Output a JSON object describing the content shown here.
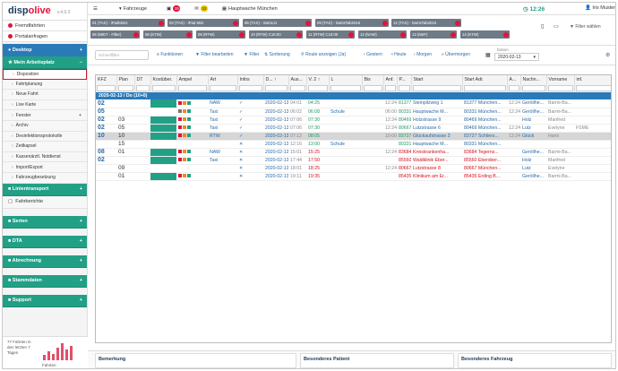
{
  "app": {
    "logo_a": "disp",
    "logo_b": "olive",
    "version": "v.4.9.3"
  },
  "topbar": {
    "fahrzeuge_label": "Fahrzeuge",
    "count_red": "15",
    "count_yellow": "33",
    "location": "Hauptwache München",
    "clock": "12:26",
    "user": "Iris Muster"
  },
  "sidebar": {
    "fremdfahrten": "Fremdfahrten",
    "portalanfragen": "Portalanfragen",
    "desktop": "Desktop",
    "mein_arbeitsplatz": "Mein Arbeitsplatz",
    "subitems": [
      "Disposition",
      "Fahrtplanung",
      "Neue Fahrt",
      "Live Karte",
      "Fenster",
      "Archiv",
      "Desinfektionsprotokolle",
      "Zeitkapsel",
      "Kassenärztl. Notdienst",
      "Import/Export",
      "Fahrzeugbesetzung"
    ],
    "linientransport": "Linientransport",
    "fahrberichte": "Fahrberichte",
    "groups": [
      "Serien",
      "DTA",
      "Abrechnung",
      "Stammdaten",
      "Support"
    ],
    "stats_text": "77 Fahrten in den letzten 7 Tagen",
    "stats_label": "Fahrten",
    "stats_values": [
      0.3,
      0.5,
      0.35,
      0.7,
      0.95,
      0.6,
      0.8
    ]
  },
  "filter_tabs": [
    "01 (TAX) - iPadMini2",
    "03 (TAX) - iPad Mini",
    "06 (TAX) - SamsJ1",
    "09 (TAX) - SamsTab2016",
    "12 (TAX) - SamsTab2016",
    "06 (MIET - Filter)",
    "08 (KTW)",
    "09 (RTW)",
    "10 (RTW) C16:00",
    "11 (RTW) C16:00",
    "12 (NAW)",
    "13 (NEF)",
    "14 (KTW)"
  ],
  "filter_waehlen": "Filter wählen",
  "toolbar": {
    "search_placeholder": "Schnellfilter",
    "funktionen": "Funktionen",
    "filter_bearbeiten": "Filter bearbeiten",
    "filter": "Filter",
    "sortierung": "Sortierung",
    "route": "Route anzeigen (Ja)",
    "gestern": "Gestern",
    "heute": "Heute",
    "morgen": "Morgen",
    "uebermorgen": "Übermorgen",
    "datum_label": "Datum",
    "datum": "2020-02-13"
  },
  "table": {
    "columns": [
      "KFZ",
      "Plan",
      "DT",
      "Kostüber.",
      "Ampel",
      "Art",
      "Infos",
      "D... ↑",
      "Aus...",
      "V. 2 ↑",
      "L",
      "Bis",
      "Anf.",
      "P...",
      "Start",
      "Start Adr.",
      "A...",
      "Nachn...",
      "Vorname",
      "inf."
    ],
    "group": "2020-02-13 / Do (10+0)",
    "rows": [
      {
        "kfz": "02",
        "plan": "",
        "gc": true,
        "amp": [
          "r",
          "o",
          "g"
        ],
        "art": "NAW",
        "info": "✓",
        "d": "2020-02-13",
        "aus": "04:01",
        "v2": "04:25",
        "l": "",
        "bis": "",
        "anf": "12:24",
        "p": "81377",
        "start": "Steinpilzweg 1",
        "adr": "81377 München...",
        "a": "12:24",
        "nach": "Geröllhe...",
        "vor": "Barmi-Ba...",
        "inf": "",
        "c": "green"
      },
      {
        "kfz": "05",
        "plan": "",
        "gc": false,
        "amp": [
          "a",
          "o",
          "g"
        ],
        "art": "Taxi",
        "info": "✓",
        "d": "2020-02-13",
        "aus": "06:02",
        "v2": "06:08",
        "l": "Schule",
        "bis": "",
        "anf": "06:00",
        "p": "80331",
        "start": "Hauptwache M...",
        "adr": "80331 München...",
        "a": "12:24",
        "nach": "Geröllhe...",
        "vor": "Barmi-Ba...",
        "inf": "",
        "c": "green"
      },
      {
        "kfz": "02",
        "plan": "03",
        "gc": true,
        "amp": [
          "r",
          "o",
          "g"
        ],
        "art": "Taxi",
        "info": "✓",
        "d": "2020-02-13",
        "aus": "07:06",
        "v2": "07:30",
        "l": "",
        "bis": "",
        "anf": "12:24",
        "p": "80469",
        "start": "Holzstrasse 9",
        "adr": "80469 München...",
        "a": "",
        "nach": "Holz",
        "vor": "Manfred",
        "inf": "",
        "c": "green"
      },
      {
        "kfz": "02",
        "plan": "05",
        "gc": true,
        "amp": [
          "r",
          "o",
          "g"
        ],
        "art": "Taxi",
        "info": "✓",
        "d": "2020-02-13",
        "aus": "07:06",
        "v2": "07:30",
        "l": "",
        "bis": "",
        "anf": "12:24",
        "p": "80667",
        "start": "Lutzstrasse 6",
        "adr": "80469 München...",
        "a": "12:24",
        "nach": "Lutz",
        "vor": "Evelyne",
        "inf": "FSME",
        "c": "green"
      },
      {
        "kfz": "10",
        "plan": "10",
        "gc": true,
        "amp": [
          "r",
          "o",
          "g"
        ],
        "art": "RTW",
        "info": "✓",
        "d": "2020-02-13",
        "aus": "07:12",
        "v2": "08:05",
        "l": "",
        "bis": "",
        "anf": "10:00",
        "p": "83727",
        "start": "Glückaufstrasse 3",
        "adr": "83727 Schliers...",
        "a": "12:24",
        "nach": "Glück",
        "vor": "Hans",
        "inf": "",
        "c": "green",
        "sel": true
      },
      {
        "kfz": "",
        "plan": "15",
        "gc": false,
        "amp": [],
        "art": "",
        "info": "✕",
        "d": "2020-02-13",
        "aus": "12:16",
        "v2": "13:00",
        "l": "Schule",
        "bis": "",
        "anf": "",
        "p": "80331",
        "start": "Hauptwache M...",
        "adr": "80331 München...",
        "a": "",
        "nach": "",
        "vor": "",
        "inf": "",
        "c": "green"
      },
      {
        "kfz": "08",
        "plan": "01",
        "gc": true,
        "amp": [
          "r",
          "o",
          "g"
        ],
        "art": "NAW",
        "info": "✕",
        "d": "2020-02-13",
        "aus": "15:01",
        "v2": "15:25",
        "l": "",
        "bis": "",
        "anf": "12:24",
        "p": "83684",
        "start": "Kreiskrankenha...",
        "adr": "83684 Tegerns...",
        "a": "",
        "nach": "Geröllhe...",
        "vor": "Barmi-Ba...",
        "inf": "",
        "c": "red"
      },
      {
        "kfz": "02",
        "plan": "",
        "gc": true,
        "amp": [
          "r",
          "o",
          "g"
        ],
        "art": "Taxi",
        "info": "✕",
        "d": "2020-02-13",
        "aus": "17:44",
        "v2": "17:50",
        "l": "",
        "bis": "",
        "anf": "",
        "p": "85560",
        "start": "Waldklinik Eber...",
        "adr": "85560 Ebersber...",
        "a": "",
        "nach": "Holz",
        "vor": "Manfred",
        "inf": "",
        "c": "red"
      },
      {
        "kfz": "",
        "plan": "09",
        "gc": false,
        "amp": [],
        "art": "",
        "info": "✕",
        "d": "2020-02-13",
        "aus": "18:01",
        "v2": "18:25",
        "l": "",
        "bis": "",
        "anf": "12:24",
        "p": "80667",
        "start": "Lutzstrasse 8",
        "adr": "80667 München...",
        "a": "",
        "nach": "Lutz",
        "vor": "Evelyne",
        "inf": "",
        "c": "red"
      },
      {
        "kfz": "",
        "plan": "01",
        "gc": true,
        "amp": [
          "r",
          "o",
          "g"
        ],
        "art": "",
        "info": "✕",
        "d": "2020-02-13",
        "aus": "19:11",
        "v2": "19:35",
        "l": "",
        "bis": "",
        "anf": "",
        "p": "85435",
        "start": "Klinikum am Er...",
        "adr": "85435 Erding B...",
        "a": "",
        "nach": "Geröllhe...",
        "vor": "Barmi-Ba...",
        "inf": "",
        "c": "red"
      }
    ]
  },
  "bottom": {
    "bemerkung": "Bemerkung",
    "patient": "Besonderes Patient",
    "fahrzeug": "Besonderes Fahrzeug"
  }
}
